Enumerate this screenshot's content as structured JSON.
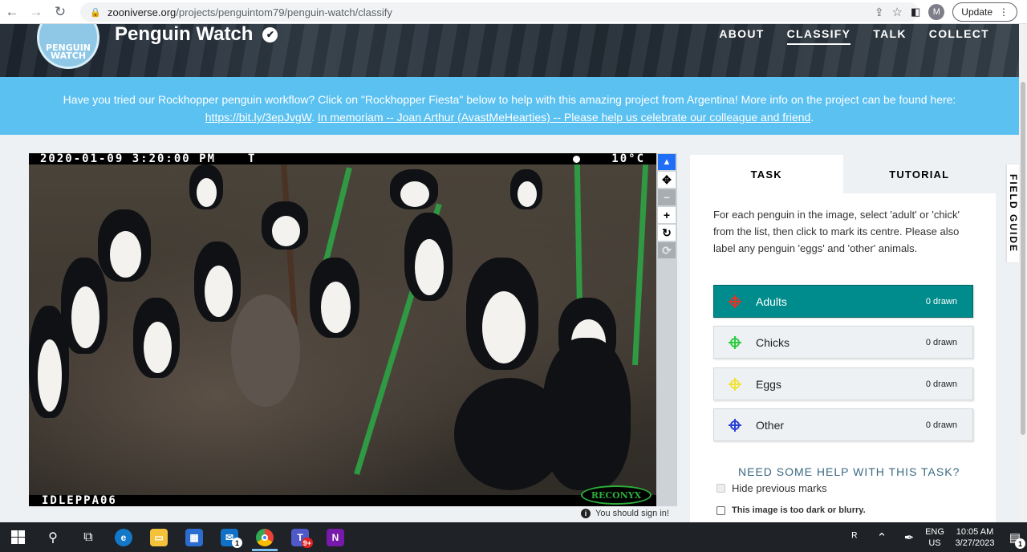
{
  "browser": {
    "url_host": "zooniverse.org",
    "url_path": "/projects/penguintom79/penguin-watch/classify",
    "profile_initial": "M",
    "update_label": "Update"
  },
  "project": {
    "logo_text": "PENGUIN WATCH",
    "title": "Penguin Watch",
    "nav": [
      "ABOUT",
      "CLASSIFY",
      "TALK",
      "COLLECT"
    ],
    "active_nav": "CLASSIFY"
  },
  "announcement": {
    "text": "Have you tried our Rockhopper penguin workflow? Click on \"Rockhopper Fiesta\" below to help with this amazing project from Argentina! More info on the project can be found here:",
    "link1": "https://bit.ly/3epJvgW",
    "sep": ". ",
    "link2": "In memoriam -- Joan Arthur (AvastMeHearties) -- Please help us celebrate our colleague and friend",
    "end": "."
  },
  "subject": {
    "timestamp": "2020-01-09 3:20:00 PM",
    "marker": "T",
    "temperature": "10°C",
    "camera_id": "IDLEPPA06",
    "brand": "RECONYX"
  },
  "tools": [
    {
      "name": "pointer-tool",
      "icon": "▲",
      "state": "active"
    },
    {
      "name": "move-tool",
      "icon": "✥",
      "state": "normal"
    },
    {
      "name": "zoom-out-tool",
      "icon": "−",
      "state": "disabled"
    },
    {
      "name": "zoom-in-tool",
      "icon": "+",
      "state": "normal"
    },
    {
      "name": "rotate-tool",
      "icon": "↻",
      "state": "normal"
    },
    {
      "name": "reset-tool",
      "icon": "⟳",
      "state": "disabled"
    }
  ],
  "sign_in_note": "You should sign in!",
  "task": {
    "tabs": [
      "TASK",
      "TUTORIAL"
    ],
    "instructions": "For each penguin in the image, select 'adult' or 'chick' from the list, then click to mark its centre. Please also label any penguin 'eggs' and 'other' animals.",
    "choices": [
      {
        "label": "Adults",
        "count": "0 drawn",
        "color": "#e0352b",
        "active": true
      },
      {
        "label": "Chicks",
        "count": "0 drawn",
        "color": "#2ecc40",
        "active": false
      },
      {
        "label": "Eggs",
        "count": "0 drawn",
        "color": "#f2e23a",
        "active": false
      },
      {
        "label": "Other",
        "count": "0 drawn",
        "color": "#2a3fd6",
        "active": false
      }
    ],
    "help_link": "NEED SOME HELP WITH THIS TASK?",
    "hide_marks": "Hide previous marks",
    "dark_image": "This image is too dark or blurry."
  },
  "field_guide": "FIELD GUIDE",
  "taskbar": {
    "badges": {
      "mail": "1",
      "teams": "9+"
    },
    "lang_top": "ENG",
    "lang_bottom": "US",
    "time": "10:05 AM",
    "date": "3/27/2023",
    "notify_count": "1"
  }
}
